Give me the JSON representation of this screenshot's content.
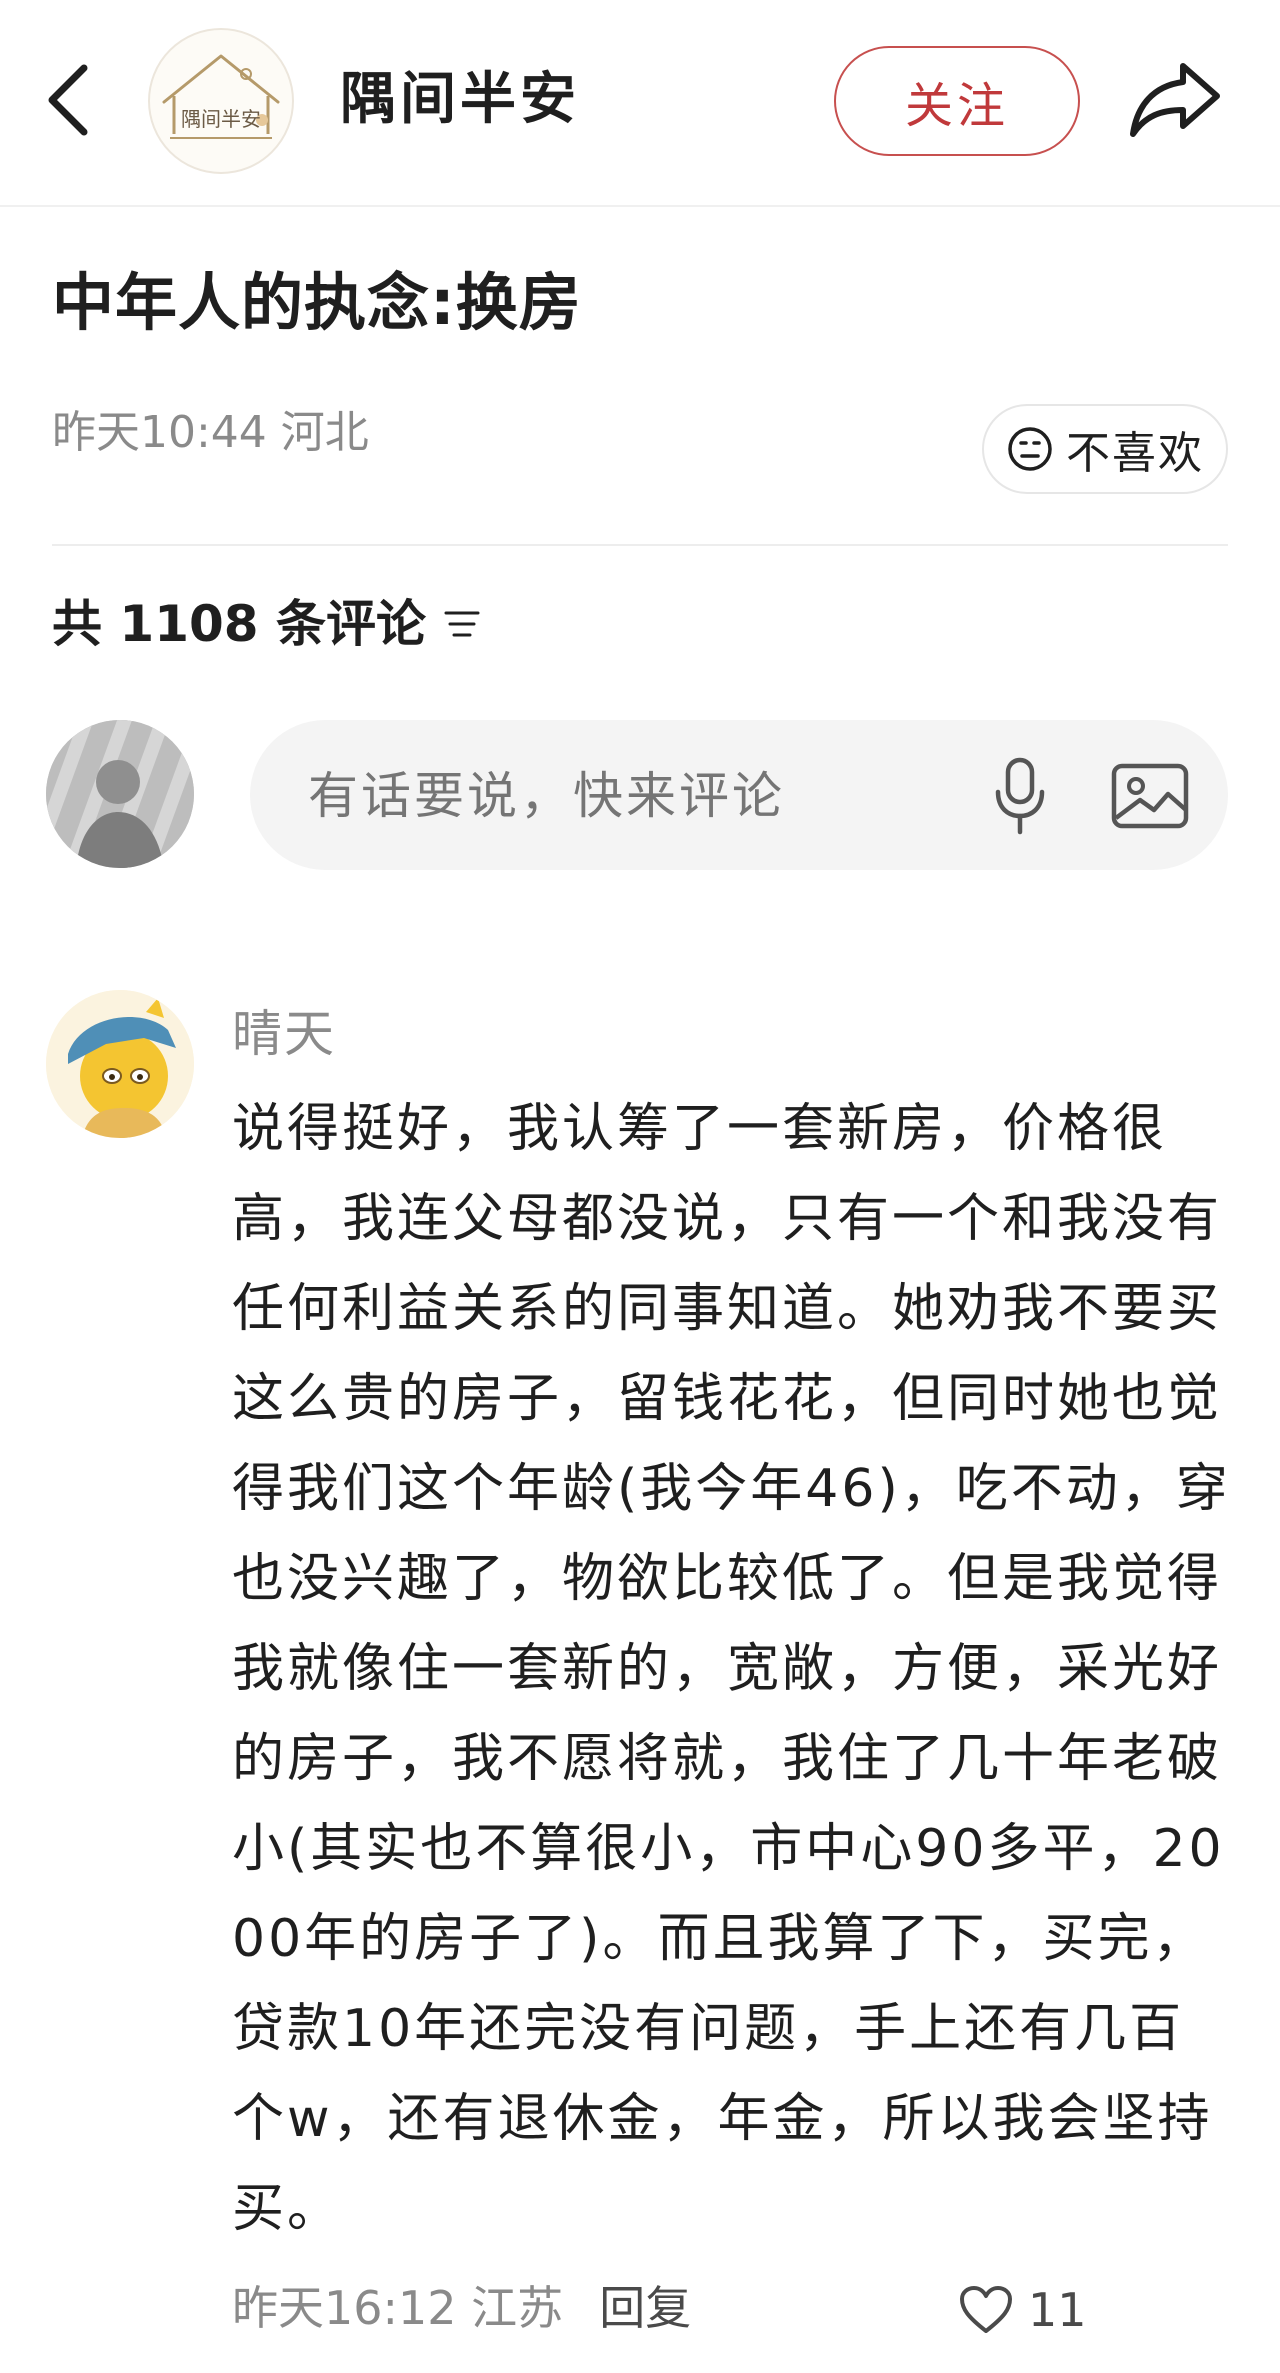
{
  "header": {
    "account_name": "隅间半安",
    "logo_text": "隅间半安",
    "follow_label": "关注"
  },
  "post": {
    "title": "中年人的执念:换房",
    "meta": "昨天10:44 河北",
    "dislike_label": "不喜欢"
  },
  "comments_section": {
    "count_label": "共 1108 条评论"
  },
  "composer": {
    "placeholder": "有话要说，快来评论"
  },
  "comment": {
    "author": "晴天",
    "body": "说得挺好，我认筹了一套新房，价格很高，我连父母都没说，只有一个和我没有任何利益关系的同事知道。她劝我不要买这么贵的房子，留钱花花，但同时她也觉得我们这个年龄(我今年46)，吃不动，穿也没兴趣了，物欲比较低了。但是我觉得我就像住一套新的，宽敞，方便，采光好的房子，我不愿将就，我住了几十年老破小(其实也不算很小，市中心90多平，2000年的房子了)。而且我算了下，买完，贷款10年还完没有问题，手上还有几百个w，还有退休金，年金，所以我会坚持买。",
    "time_location": "昨天16:12 江苏",
    "reply_label": "回复",
    "like_count": "11"
  },
  "colors": {
    "accent": "#c0393b",
    "muted_text": "#8a8a8a",
    "composer_bg": "#f4f4f4"
  },
  "icons": [
    "back-icon",
    "logo-house-icon",
    "share-icon",
    "neutral-face-icon",
    "sort-icon",
    "microphone-icon",
    "image-icon",
    "heart-icon"
  ]
}
